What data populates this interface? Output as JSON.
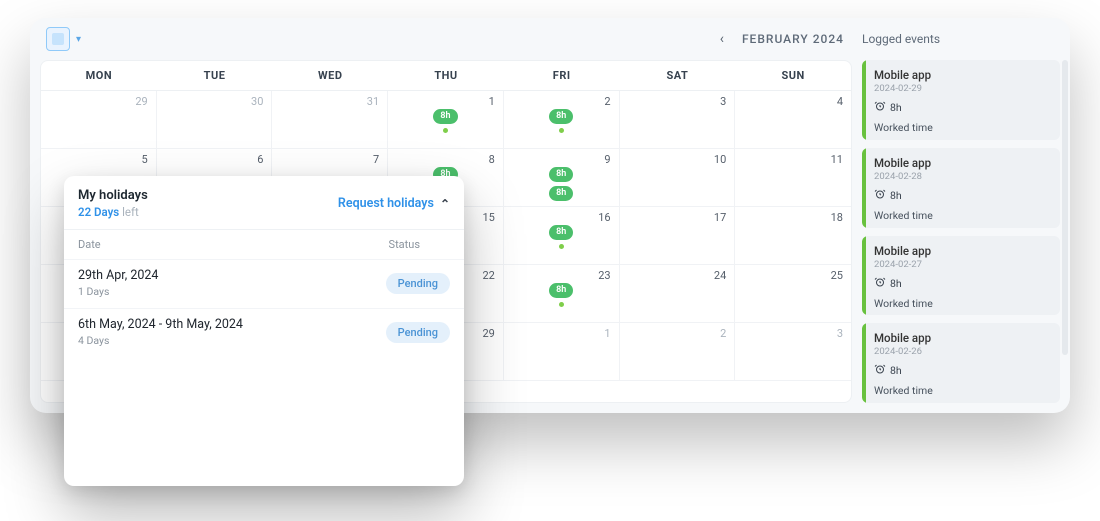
{
  "topbar": {
    "month_label": "FEBRUARY 2024",
    "logged_events_label": "Logged events"
  },
  "calendar": {
    "headers": [
      "MON",
      "TUE",
      "WED",
      "THU",
      "FRI",
      "SAT",
      "SUN"
    ],
    "pill_label": "8h",
    "cells": [
      {
        "n": "29",
        "c": false,
        "p": 0,
        "d": 0
      },
      {
        "n": "30",
        "c": false,
        "p": 0,
        "d": 0
      },
      {
        "n": "31",
        "c": false,
        "p": 0,
        "d": 0
      },
      {
        "n": "1",
        "c": true,
        "p": 1,
        "d": 1
      },
      {
        "n": "2",
        "c": true,
        "p": 1,
        "d": 1
      },
      {
        "n": "3",
        "c": true,
        "p": 0,
        "d": 0
      },
      {
        "n": "4",
        "c": true,
        "p": 0,
        "d": 0
      },
      {
        "n": "5",
        "c": true,
        "p": 0,
        "d": 0
      },
      {
        "n": "6",
        "c": true,
        "p": 0,
        "d": 0
      },
      {
        "n": "7",
        "c": true,
        "p": 0,
        "d": 0
      },
      {
        "n": "8",
        "c": true,
        "p": 2,
        "d": 1
      },
      {
        "n": "9",
        "c": true,
        "p": 2,
        "d": 0
      },
      {
        "n": "10",
        "c": true,
        "p": 0,
        "d": 0
      },
      {
        "n": "11",
        "c": true,
        "p": 0,
        "d": 0
      },
      {
        "n": "",
        "c": true,
        "p": 0,
        "d": 0
      },
      {
        "n": "",
        "c": true,
        "p": 0,
        "d": 0
      },
      {
        "n": "",
        "c": true,
        "p": 0,
        "d": 0
      },
      {
        "n": "15",
        "c": true,
        "p": 1,
        "d": 1
      },
      {
        "n": "16",
        "c": true,
        "p": 1,
        "d": 1
      },
      {
        "n": "17",
        "c": true,
        "p": 0,
        "d": 0
      },
      {
        "n": "18",
        "c": true,
        "p": 0,
        "d": 0
      },
      {
        "n": "",
        "c": true,
        "p": 0,
        "d": 0
      },
      {
        "n": "",
        "c": true,
        "p": 0,
        "d": 0
      },
      {
        "n": "",
        "c": true,
        "p": 0,
        "d": 0
      },
      {
        "n": "22",
        "c": true,
        "p": 1,
        "d": 1
      },
      {
        "n": "23",
        "c": true,
        "p": 1,
        "d": 1
      },
      {
        "n": "24",
        "c": true,
        "p": 0,
        "d": 0
      },
      {
        "n": "25",
        "c": true,
        "p": 0,
        "d": 0
      },
      {
        "n": "",
        "c": true,
        "p": 0,
        "d": 0
      },
      {
        "n": "",
        "c": true,
        "p": 0,
        "d": 0
      },
      {
        "n": "",
        "c": true,
        "p": 0,
        "d": 0
      },
      {
        "n": "29",
        "c": true,
        "p": 1,
        "d": 0
      },
      {
        "n": "1",
        "c": false,
        "p": 0,
        "d": 0
      },
      {
        "n": "2",
        "c": false,
        "p": 0,
        "d": 0
      },
      {
        "n": "3",
        "c": false,
        "p": 0,
        "d": 0
      }
    ]
  },
  "events": [
    {
      "title": "Mobile app",
      "date": "2024-02-29",
      "hours": "8h",
      "kind": "Worked time"
    },
    {
      "title": "Mobile app",
      "date": "2024-02-28",
      "hours": "8h",
      "kind": "Worked time"
    },
    {
      "title": "Mobile app",
      "date": "2024-02-27",
      "hours": "8h",
      "kind": "Worked time"
    },
    {
      "title": "Mobile app",
      "date": "2024-02-26",
      "hours": "8h",
      "kind": "Worked time"
    }
  ],
  "holidays": {
    "title": "My holidays",
    "days_left_value": "22 Days",
    "days_left_suffix": "left",
    "request_label": "Request holidays",
    "col_date": "Date",
    "col_status": "Status",
    "rows": [
      {
        "date": "29th Apr, 2024",
        "days": "1 Days",
        "status": "Pending"
      },
      {
        "date": "6th May, 2024 - 9th May, 2024",
        "days": "4 Days",
        "status": "Pending"
      }
    ]
  }
}
